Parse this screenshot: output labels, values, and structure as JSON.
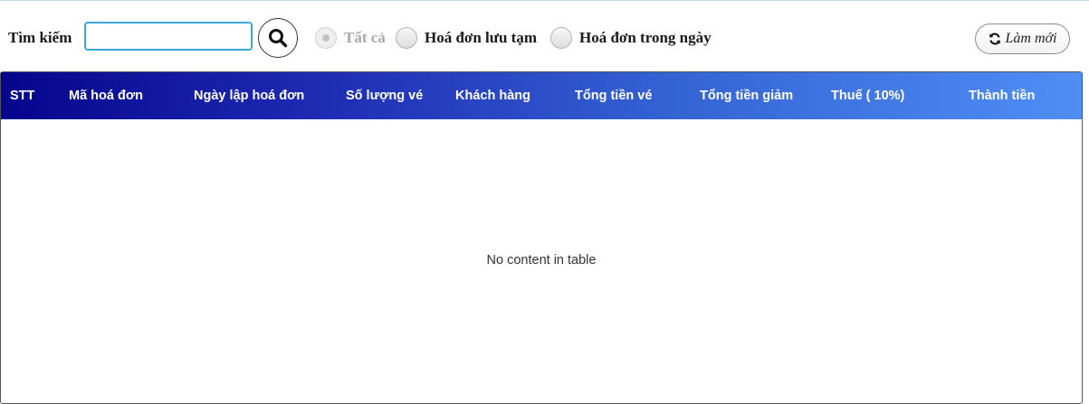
{
  "search": {
    "label": "Tìm kiếm",
    "value": "",
    "placeholder": ""
  },
  "filters": {
    "options": [
      {
        "label": "Tất cả",
        "checked": true,
        "disabled": true
      },
      {
        "label": "Hoá đơn lưu tạm",
        "checked": false,
        "disabled": false
      },
      {
        "label": "Hoá đơn trong ngày",
        "checked": false,
        "disabled": false
      }
    ]
  },
  "refresh": {
    "label": "Làm mới",
    "icon": "refresh-icon"
  },
  "table": {
    "columns": [
      "STT",
      "Mã hoá đơn",
      "Ngày lập hoá đơn",
      "Số lượng vé",
      "Khách hàng",
      "Tổng tiền vé",
      "Tổng tiền giảm",
      "Thuế ( 10%)",
      "Thành tiền"
    ],
    "rows": [],
    "empty_message": "No content in table"
  },
  "colors": {
    "header_start": "#05058c",
    "header_end": "#4f8ef5",
    "search_border": "#3aa9d8"
  }
}
